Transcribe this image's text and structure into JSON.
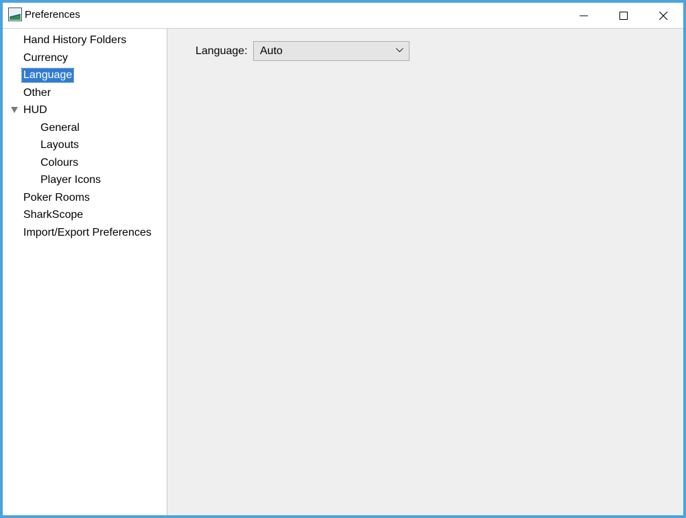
{
  "window": {
    "title": "Preferences",
    "controls": {
      "minimize": "minimize-icon",
      "maximize": "maximize-icon",
      "close": "close-icon"
    }
  },
  "sidebar": {
    "items": [
      {
        "label": "Hand History Folders",
        "selected": false
      },
      {
        "label": "Currency",
        "selected": false
      },
      {
        "label": "Language",
        "selected": true
      },
      {
        "label": "Other",
        "selected": false
      },
      {
        "label": "HUD",
        "selected": false,
        "expanded": true
      },
      {
        "label": "General",
        "selected": false
      },
      {
        "label": "Layouts",
        "selected": false
      },
      {
        "label": "Colours",
        "selected": false
      },
      {
        "label": "Player Icons",
        "selected": false
      },
      {
        "label": "Poker Rooms",
        "selected": false
      },
      {
        "label": "SharkScope",
        "selected": false
      },
      {
        "label": "Import/Export Preferences",
        "selected": false
      }
    ]
  },
  "language_panel": {
    "label": "Language:",
    "selected_value": "Auto"
  },
  "colors": {
    "accent": "#4aa3df",
    "selection": "#2f7bd5"
  }
}
